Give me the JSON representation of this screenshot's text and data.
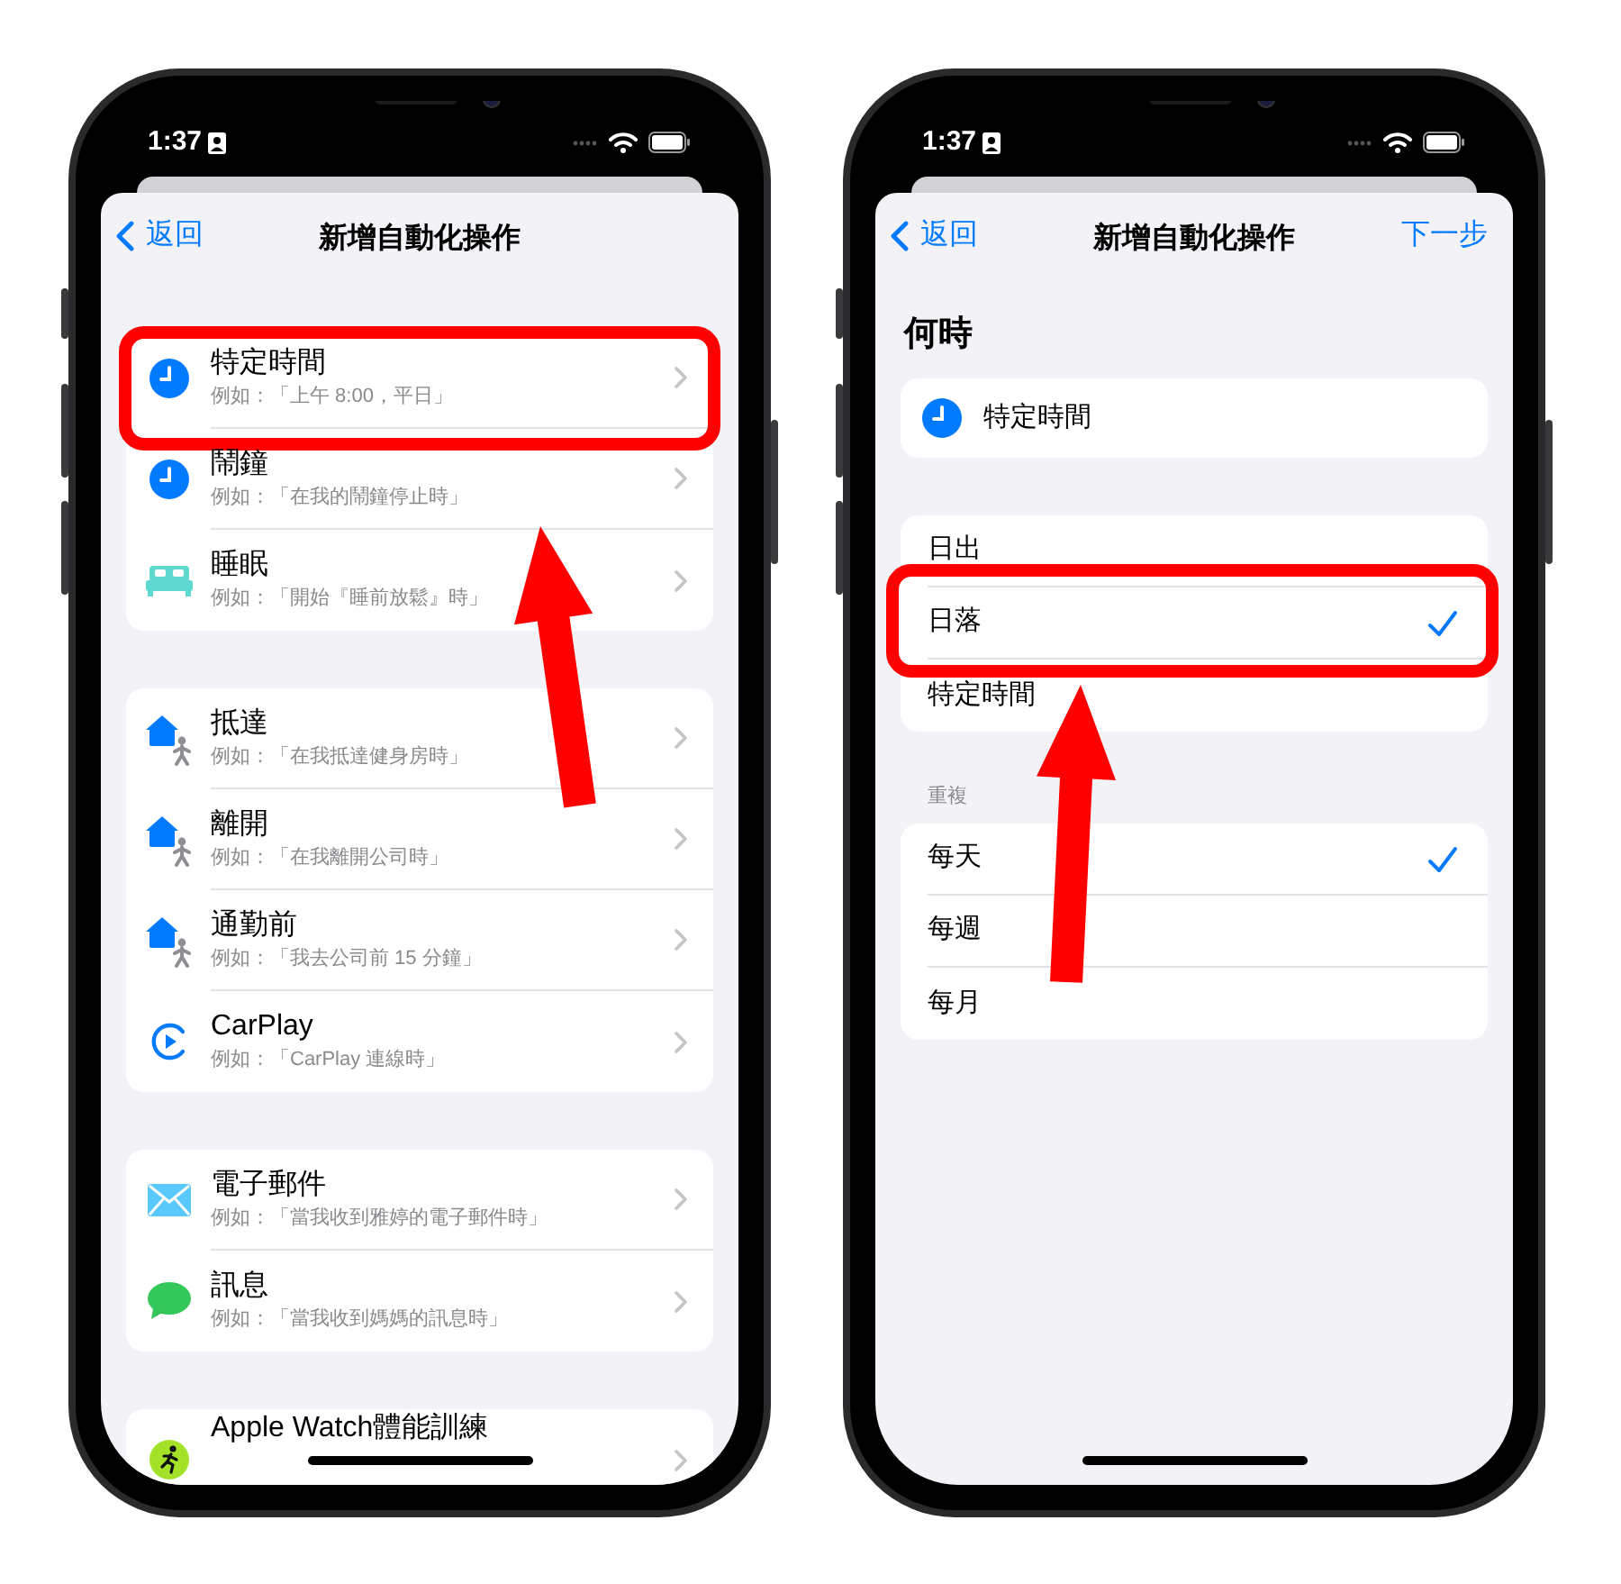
{
  "phones": [
    {
      "status_bar": {
        "time": "1:37"
      },
      "nav": {
        "back": "返回",
        "title": "新增自動化操作"
      },
      "groups": [
        [
          {
            "kind": "clock",
            "title": "特定時間",
            "subtitle": "例如：「上午 8:00，平日」",
            "highlighted": true
          },
          {
            "kind": "clock",
            "title": "鬧鐘",
            "subtitle": "例如：「在我的鬧鐘停止時」",
            "highlighted": false
          },
          {
            "kind": "bed",
            "title": "睡眠",
            "subtitle": "例如：「開始『睡前放鬆』時」",
            "highlighted": false
          }
        ],
        [
          {
            "kind": "location",
            "title": "抵達",
            "subtitle": "例如：「在我抵達健身房時」",
            "highlighted": false
          },
          {
            "kind": "location",
            "title": "離開",
            "subtitle": "例如：「在我離開公司時」",
            "highlighted": false
          },
          {
            "kind": "location",
            "title": "通勤前",
            "subtitle": "例如：「我去公司前 15 分鐘」",
            "highlighted": false
          },
          {
            "kind": "carplay",
            "title": "CarPlay",
            "subtitle": "例如：「CarPlay 連線時」",
            "highlighted": false
          }
        ],
        [
          {
            "kind": "mail",
            "title": "電子郵件",
            "subtitle": "例如：「當我收到雅婷的電子郵件時」",
            "highlighted": false
          },
          {
            "kind": "message",
            "title": "訊息",
            "subtitle": "例如：「當我收到媽媽的訊息時」",
            "highlighted": false
          }
        ],
        [
          {
            "kind": "workout",
            "title": "Apple Watch體能訓練",
            "highlighted": false
          }
        ]
      ]
    },
    {
      "status_bar": {
        "time": "1:37"
      },
      "nav": {
        "back": "返回",
        "title": "新增自動化操作",
        "next": "下一步"
      },
      "heading": "何時",
      "trigger": {
        "kind": "clock",
        "label": "特定時間"
      },
      "options": [
        {
          "label": "日出",
          "selected": false,
          "highlighted": false
        },
        {
          "label": "日落",
          "selected": true,
          "highlighted": true
        },
        {
          "label": "特定時間",
          "selected": false,
          "highlighted": false
        }
      ],
      "repeat_label": "重複",
      "repeat": [
        {
          "label": "每天",
          "selected": true
        },
        {
          "label": "每週",
          "selected": false
        },
        {
          "label": "每月",
          "selected": false
        }
      ]
    }
  ]
}
